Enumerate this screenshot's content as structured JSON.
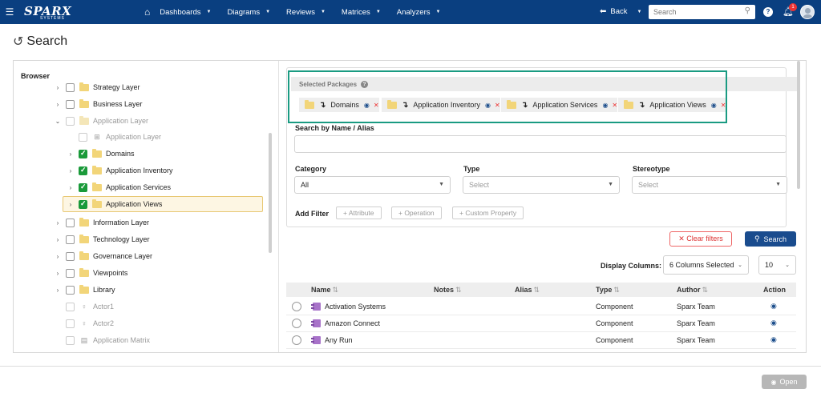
{
  "header": {
    "logo_main": "SPARX",
    "logo_sub": "SYSTEMS",
    "nav": [
      "Dashboards",
      "Diagrams",
      "Reviews",
      "Matrices",
      "Analyzers"
    ],
    "back_label": "Back",
    "search_placeholder": "Search",
    "help": "?",
    "notification_count": "1"
  },
  "page_title": "Search",
  "browser": {
    "title": "Browser",
    "items": [
      "Strategy Layer",
      "Business Layer",
      "Application Layer",
      "Application Layer",
      "Domains",
      "Application Inventory",
      "Application Services",
      "Application Views",
      "Information Layer",
      "Technology Layer",
      "Governance Layer",
      "Viewpoints",
      "Library",
      "Actor1",
      "Actor2",
      "Application Matrix"
    ]
  },
  "selected_packages": {
    "title": "Selected Packages",
    "help": "?",
    "chips": [
      "Domains",
      "Application Inventory",
      "Application Services",
      "Application Views"
    ]
  },
  "filters": {
    "name_label": "Search by Name / Alias",
    "category_label": "Category",
    "category_value": "All",
    "type_label": "Type",
    "type_placeholder": "Select",
    "stereotype_label": "Stereotype",
    "stereotype_placeholder": "Select",
    "add_filter_label": "Add Filter",
    "add_buttons": [
      "+ Attribute",
      "+ Operation",
      "+ Custom Property"
    ]
  },
  "actions": {
    "clear_filters": "✕ Clear filters",
    "search": "Search"
  },
  "display": {
    "label": "Display Columns:",
    "columns_value": "6 Columns Selected",
    "page_size": "10"
  },
  "table": {
    "headers": [
      "Name",
      "Notes",
      "Alias",
      "Type",
      "Author",
      "Action"
    ],
    "sort_glyph": "⇅",
    "rows": [
      {
        "name": "Activation Systems",
        "notes": "",
        "alias": "",
        "type": "Component",
        "author": "Sparx Team"
      },
      {
        "name": "Amazon Connect",
        "notes": "",
        "alias": "",
        "type": "Component",
        "author": "Sparx Team"
      },
      {
        "name": "Any Run",
        "notes": "",
        "alias": "",
        "type": "Component",
        "author": "Sparx Team"
      }
    ]
  },
  "footer": {
    "open_label": "Open"
  }
}
